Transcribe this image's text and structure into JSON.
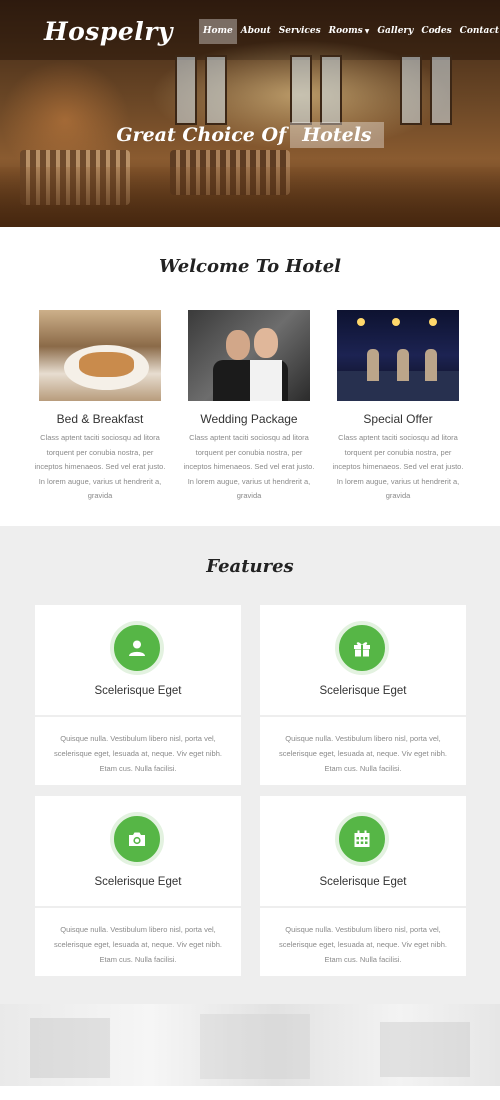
{
  "brand": {
    "name": "Hospelry"
  },
  "nav": {
    "items": [
      {
        "label": "Home",
        "active": true
      },
      {
        "label": "About"
      },
      {
        "label": "Services"
      },
      {
        "label": "Rooms",
        "dropdown": true
      },
      {
        "label": "Gallery"
      },
      {
        "label": "Codes"
      },
      {
        "label": "Contact"
      }
    ]
  },
  "hero": {
    "title_prefix": "Great Choice Of",
    "title_highlight": "Hotels"
  },
  "welcome": {
    "title": "Welcome To Hotel",
    "cards": [
      {
        "title": "Bed & Breakfast",
        "text": "Class aptent taciti sociosqu ad litora torquent per conubia nostra, per inceptos himenaeos. Sed vel erat justo. In lorem augue, varius ut hendrerit a, gravida"
      },
      {
        "title": "Wedding Package",
        "text": "Class aptent taciti sociosqu ad litora torquent per conubia nostra, per inceptos himenaeos. Sed vel erat justo. In lorem augue, varius ut hendrerit a, gravida"
      },
      {
        "title": "Special Offer",
        "text": "Class aptent taciti sociosqu ad litora torquent per conubia nostra, per inceptos himenaeos. Sed vel erat justo. In lorem augue, varius ut hendrerit a, gravida"
      }
    ]
  },
  "features": {
    "title": "Features",
    "accent_color": "#56b646",
    "items": [
      {
        "icon": "user-icon",
        "title": "Scelerisque Eget",
        "text": "Quisque nulla. Vestibulum libero nisl, porta vel, scelerisque eget, lesuada at, neque. Viv eget nibh. Etam cus. Nulla facilisi."
      },
      {
        "icon": "gift-icon",
        "title": "Scelerisque Eget",
        "text": "Quisque nulla. Vestibulum libero nisl, porta vel, scelerisque eget, lesuada at, neque. Viv eget nibh. Etam cus. Nulla facilisi."
      },
      {
        "icon": "camera-icon",
        "title": "Scelerisque Eget",
        "text": "Quisque nulla. Vestibulum libero nisl, porta vel, scelerisque eget, lesuada at, neque. Viv eget nibh. Etam cus. Nulla facilisi."
      },
      {
        "icon": "calendar-icon",
        "title": "Scelerisque Eget",
        "text": "Quisque nulla. Vestibulum libero nisl, porta vel, scelerisque eget, lesuada at, neque. Viv eget nibh. Etam cus. Nulla facilisi."
      }
    ]
  }
}
